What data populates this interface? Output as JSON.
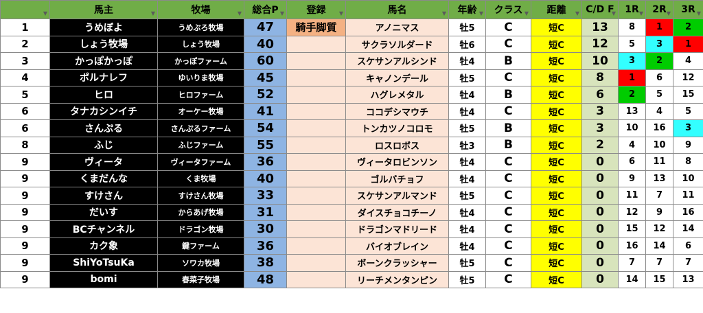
{
  "headers": {
    "rank": "",
    "owner": "馬主",
    "farm": "牧場",
    "points": "総合P",
    "registration": "登録",
    "horse": "馬名",
    "age": "年齢",
    "class": "クラス",
    "distance": "距離",
    "cdf": "C/D F",
    "r1": "1R",
    "r2": "2R",
    "r3": "3R"
  },
  "rows": [
    {
      "rank": "1",
      "owner": "うめぼよ",
      "farm": "うめぶろ牧場",
      "points": "47",
      "registration": "騎手脚質",
      "horse": "アノニマス",
      "age": "牡5",
      "class": "C",
      "distance": "短C",
      "cdf": "13",
      "r1": "8",
      "r2": "1",
      "r3": "2"
    },
    {
      "rank": "2",
      "owner": "しょう牧場",
      "farm": "しょう牧場",
      "points": "40",
      "registration": "",
      "horse": "サクラソルダード",
      "age": "牡6",
      "class": "C",
      "distance": "短C",
      "cdf": "12",
      "r1": "5",
      "r2": "3",
      "r3": "1"
    },
    {
      "rank": "3",
      "owner": "かっぽかっぽ",
      "farm": "かっぽファーム",
      "points": "60",
      "registration": "",
      "horse": "スケサンアルシンド",
      "age": "牡4",
      "class": "B",
      "distance": "短C",
      "cdf": "10",
      "r1": "3",
      "r2": "2",
      "r3": "4"
    },
    {
      "rank": "4",
      "owner": "ポルナレフ",
      "farm": "ゆいりま牧場",
      "points": "45",
      "registration": "",
      "horse": "キャノンデール",
      "age": "牡5",
      "class": "C",
      "distance": "短C",
      "cdf": "8",
      "r1": "1",
      "r2": "6",
      "r3": "12"
    },
    {
      "rank": "5",
      "owner": "ヒロ",
      "farm": "ヒロファーム",
      "points": "52",
      "registration": "",
      "horse": "ハグレメタル",
      "age": "牡4",
      "class": "B",
      "distance": "短C",
      "cdf": "6",
      "r1": "2",
      "r2": "5",
      "r3": "15"
    },
    {
      "rank": "6",
      "owner": "タナカシンイチ",
      "farm": "オーケー牧場",
      "points": "41",
      "registration": "",
      "horse": "ココデシマウチ",
      "age": "牡4",
      "class": "C",
      "distance": "短C",
      "cdf": "3",
      "r1": "13",
      "r2": "4",
      "r3": "5"
    },
    {
      "rank": "6",
      "owner": "さんぷる",
      "farm": "さんぷるファーム",
      "points": "54",
      "registration": "",
      "horse": "トンカツノコロモ",
      "age": "牡5",
      "class": "B",
      "distance": "短C",
      "cdf": "3",
      "r1": "10",
      "r2": "16",
      "r3": "3"
    },
    {
      "rank": "8",
      "owner": "ふじ",
      "farm": "ふじファーム",
      "points": "55",
      "registration": "",
      "horse": "ロスロボス",
      "age": "牡3",
      "class": "B",
      "distance": "短C",
      "cdf": "2",
      "r1": "4",
      "r2": "10",
      "r3": "9"
    },
    {
      "rank": "9",
      "owner": "ヴィータ",
      "farm": "ヴィータファーム",
      "points": "36",
      "registration": "",
      "horse": "ヴィータロビンソン",
      "age": "牡4",
      "class": "C",
      "distance": "短C",
      "cdf": "0",
      "r1": "6",
      "r2": "11",
      "r3": "8"
    },
    {
      "rank": "9",
      "owner": "くまだんな",
      "farm": "くま牧場",
      "points": "40",
      "registration": "",
      "horse": "ゴルバチョフ",
      "age": "牡4",
      "class": "C",
      "distance": "短C",
      "cdf": "0",
      "r1": "9",
      "r2": "13",
      "r3": "10"
    },
    {
      "rank": "9",
      "owner": "すけさん",
      "farm": "すけさん牧場",
      "points": "33",
      "registration": "",
      "horse": "スケサンアルマンド",
      "age": "牡5",
      "class": "C",
      "distance": "短C",
      "cdf": "0",
      "r1": "11",
      "r2": "7",
      "r3": "11"
    },
    {
      "rank": "9",
      "owner": "だいす",
      "farm": "からあげ牧場",
      "points": "31",
      "registration": "",
      "horse": "ダイスチョコチーノ",
      "age": "牡4",
      "class": "C",
      "distance": "短C",
      "cdf": "0",
      "r1": "12",
      "r2": "9",
      "r3": "16"
    },
    {
      "rank": "9",
      "owner": "BCチャンネル",
      "farm": "ドラゴン牧場",
      "points": "30",
      "registration": "",
      "horse": "ドラゴンマドリード",
      "age": "牡4",
      "class": "C",
      "distance": "短C",
      "cdf": "0",
      "r1": "15",
      "r2": "12",
      "r3": "14"
    },
    {
      "rank": "9",
      "owner": "カク象",
      "farm": "鍵ファーム",
      "points": "36",
      "registration": "",
      "horse": "バイオブレイン",
      "age": "牡4",
      "class": "C",
      "distance": "短C",
      "cdf": "0",
      "r1": "16",
      "r2": "14",
      "r3": "6"
    },
    {
      "rank": "9",
      "owner": "ShiYoTsuKa",
      "farm": "ソワカ牧場",
      "points": "38",
      "registration": "",
      "horse": "ボーンクラッシャー",
      "age": "牡5",
      "class": "C",
      "distance": "短C",
      "cdf": "0",
      "r1": "7",
      "r2": "7",
      "r3": "7"
    },
    {
      "rank": "9",
      "owner": "bomi",
      "farm": "春菜子牧場",
      "points": "48",
      "registration": "",
      "horse": "リーチメンタンピン",
      "age": "牡5",
      "class": "C",
      "distance": "短C",
      "cdf": "0",
      "r1": "14",
      "r2": "15",
      "r3": "13"
    }
  ],
  "highlight_colors": {
    "1": "#ff0000",
    "2": "#00cc00",
    "3": "#33ffff"
  },
  "filter_icon": "filter-dropdown-arrow-icon",
  "sort_filter_icon": "sort-filter-arrow-icon"
}
